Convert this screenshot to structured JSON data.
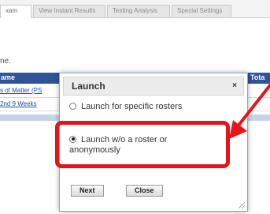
{
  "tabs": [
    {
      "label": "xam"
    },
    {
      "label": "View Instant Results"
    },
    {
      "label": "Testing Analysis"
    },
    {
      "label": "Special Settings"
    }
  ],
  "background": {
    "partial_text": "ne.",
    "table_header": {
      "col1": "ame",
      "col2": "n Tota"
    },
    "rows": [
      {
        "label": "s of Matter (PS"
      },
      {
        "label": "2nd 9 Weeks"
      }
    ]
  },
  "dialog": {
    "title": "Launch",
    "close": "×",
    "option1": "Launch for specific rosters",
    "option2_line1": "Launch w/o a roster or",
    "option2_line2": "anonymously",
    "selected_option": 2,
    "next_label": "Next",
    "close_label": "Close"
  },
  "annotation": {
    "highlight_color": "#e3141b"
  }
}
